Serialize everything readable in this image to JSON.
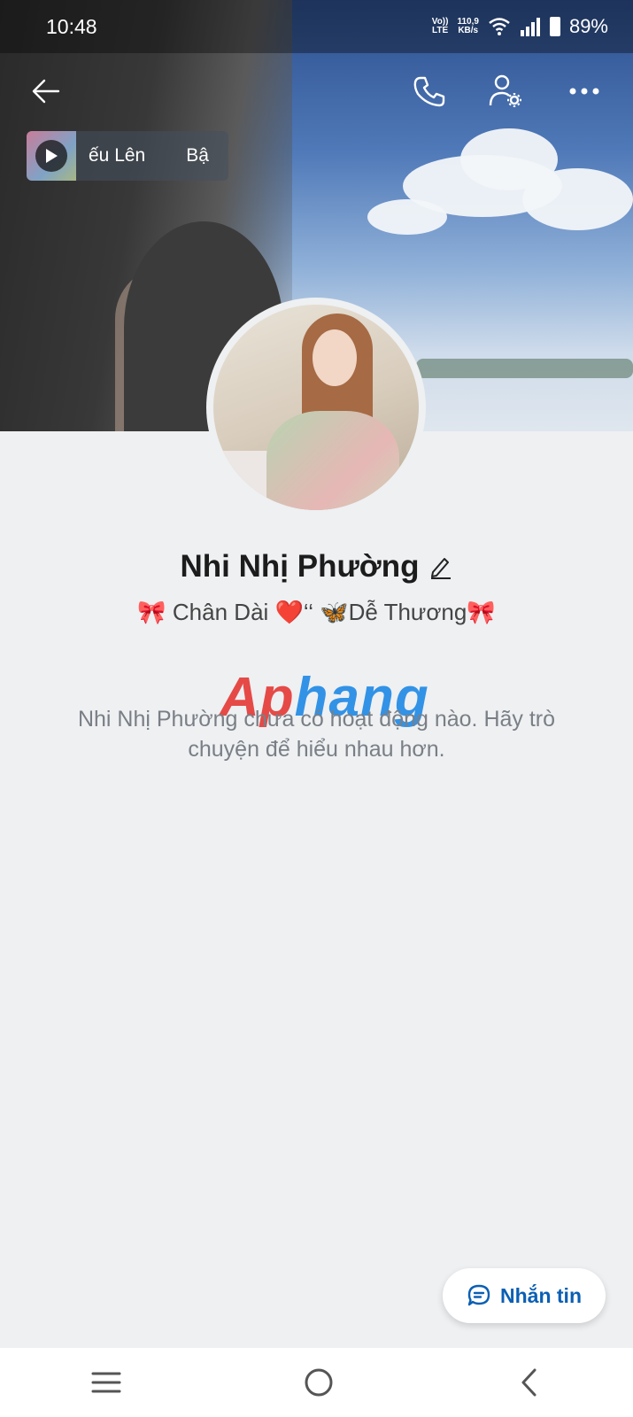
{
  "status_bar": {
    "time": "10:48",
    "network_label_top": "Vo))",
    "network_label_bottom": "LTE",
    "speed_top": "110,9",
    "speed_bottom": "KB/s",
    "battery": "89%"
  },
  "header": {
    "back_icon": "arrow-left-icon",
    "call_icon": "phone-icon",
    "settings_icon": "user-gear-icon",
    "more_icon": "more-dots-icon"
  },
  "music": {
    "text_1": "ếu Lên",
    "text_2": "Bậ"
  },
  "profile": {
    "name": "Nhi Nhị Phường",
    "bio": "🎀  Chân Dài ❤️‘‘ 🦋Dễ Thương🎀",
    "empty_message": "Nhi Nhị Phường chưa có hoạt động nào. Hãy trò chuyện để hiểu nhau hơn."
  },
  "watermark": {
    "part_a": "Ap",
    "part_b": "hang"
  },
  "message_button": {
    "label": "Nhắn tin"
  },
  "colors": {
    "accent": "#0a5fb4",
    "background": "#eef0f2"
  }
}
